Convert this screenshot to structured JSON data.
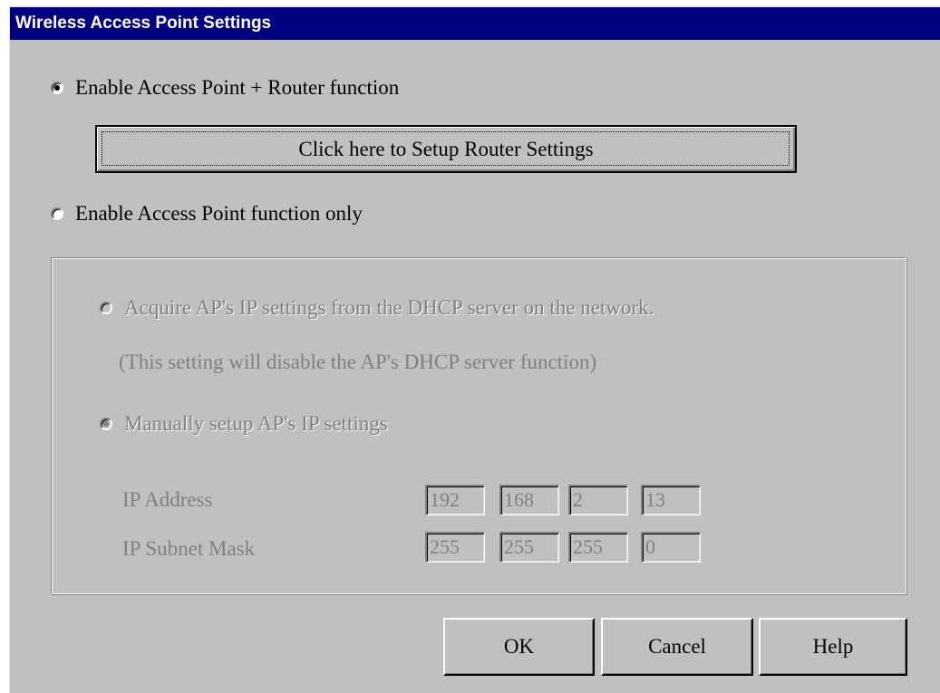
{
  "window": {
    "title": "Wireless Access Point Settings"
  },
  "mode_options": {
    "router": {
      "label": "Enable Access Point + Router function",
      "checked": true
    },
    "router_setup_button": "Click here to Setup Router Settings",
    "ap_only": {
      "label": "Enable Access Point function only",
      "checked": false
    }
  },
  "ap_group": {
    "dhcp": {
      "label": "Acquire AP's IP settings from the DHCP server on the network.",
      "note": "(This setting will disable the AP's DHCP server function)",
      "checked": false,
      "enabled": false
    },
    "manual": {
      "label": "Manually setup AP's IP settings",
      "checked": true,
      "enabled": false
    },
    "ip_address": {
      "label": "IP Address",
      "octets": [
        "192",
        "168",
        "2",
        "13"
      ]
    },
    "subnet_mask": {
      "label": "IP Subnet Mask",
      "octets": [
        "255",
        "255",
        "255",
        "0"
      ]
    }
  },
  "buttons": {
    "ok": "OK",
    "cancel": "Cancel",
    "help": "Help"
  },
  "colors": {
    "titlebar": "#000080",
    "dialog_face": "#c0c0c0",
    "disabled_text": "#808080"
  }
}
